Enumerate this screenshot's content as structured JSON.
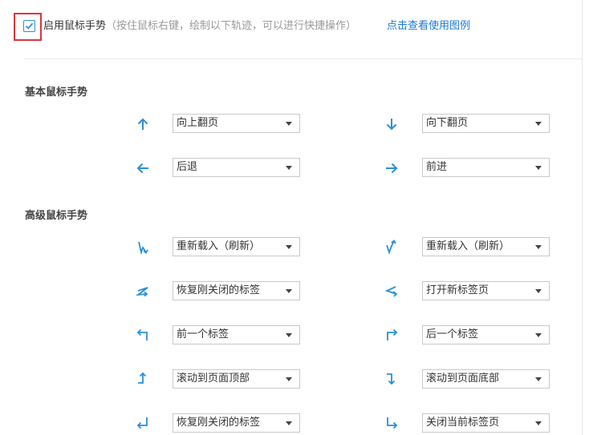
{
  "enable": {
    "label": "启用鼠标手势",
    "hint": "（按住鼠标右键，绘制以下轨迹，可以进行快捷操作）",
    "checked": true,
    "legend_link": "点击查看使用图例"
  },
  "sections": {
    "basic_title": "基本鼠标手势",
    "advanced_title": "高级鼠标手势"
  },
  "gestures": {
    "up": {
      "icon": "arrow-up-icon",
      "action": "向上翻页"
    },
    "down": {
      "icon": "arrow-down-icon",
      "action": "向下翻页"
    },
    "left": {
      "icon": "arrow-left-icon",
      "action": "后退"
    },
    "right": {
      "icon": "arrow-right-icon",
      "action": "前进"
    },
    "down_up": {
      "icon": "down-up-gesture-icon",
      "action": "重新载入（刷新）"
    },
    "up_down": {
      "icon": "up-down-gesture-icon",
      "action": "重新载入（刷新）"
    },
    "right_left": {
      "icon": "right-left-gesture-icon",
      "action": "恢复刚关闭的标签"
    },
    "left_right": {
      "icon": "left-right-gesture-icon",
      "action": "打开新标签页"
    },
    "up_left": {
      "icon": "up-left-gesture-icon",
      "action": "前一个标签"
    },
    "up_right": {
      "icon": "up-right-gesture-icon",
      "action": "后一个标签"
    },
    "right_up": {
      "icon": "right-up-gesture-icon",
      "action": "滚动到页面顶部"
    },
    "right_down": {
      "icon": "right-down-gesture-icon",
      "action": "滚动到页面底部"
    },
    "down_left": {
      "icon": "down-left-gesture-icon",
      "action": "恢复刚关闭的标签"
    },
    "down_right": {
      "icon": "down-right-gesture-icon",
      "action": "关闭当前标签页"
    }
  },
  "colors": {
    "accent": "#1a7ad6",
    "highlight_border": "#d9363e",
    "icon": "#2b8fd9"
  }
}
